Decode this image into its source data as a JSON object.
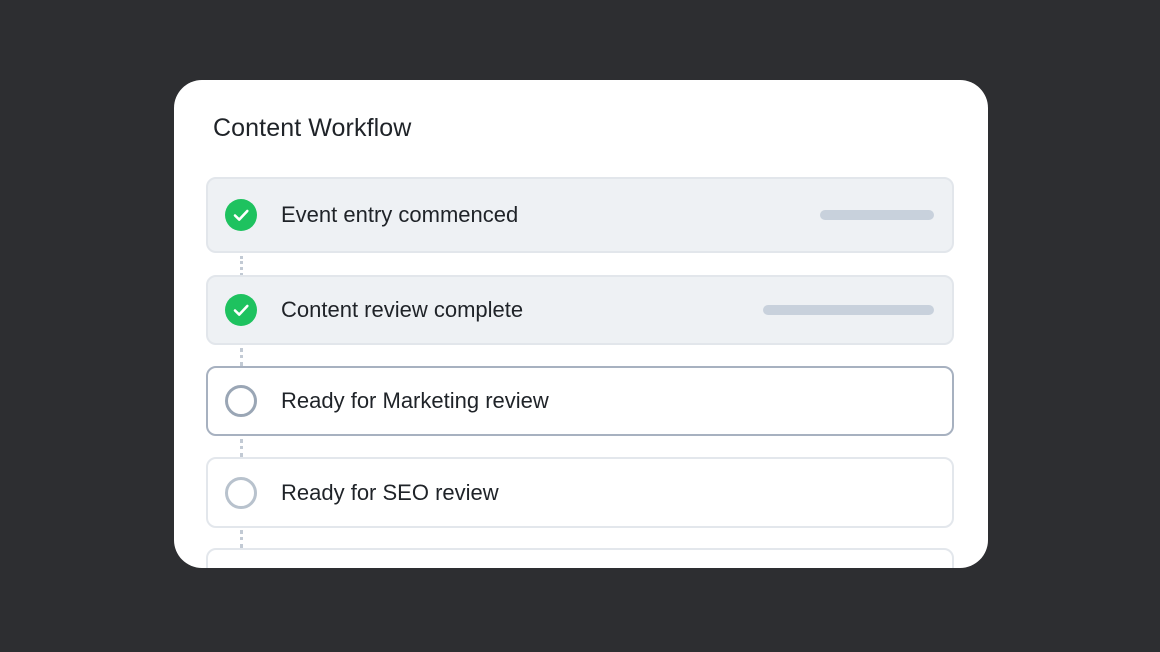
{
  "workflow": {
    "title": "Content Workflow",
    "steps": [
      {
        "label": "Event entry commenced",
        "status": "complete"
      },
      {
        "label": "Content review complete",
        "status": "complete"
      },
      {
        "label": "Ready for Marketing review",
        "status": "current"
      },
      {
        "label": "Ready for SEO review",
        "status": "pending"
      },
      {
        "label": "",
        "status": "pending"
      }
    ]
  },
  "icons": {
    "complete": "checkmark-circle-icon",
    "pending": "empty-circle-icon"
  },
  "colors": {
    "background": "#2d2e31",
    "card": "#ffffff",
    "complete_green": "#1ec25f",
    "done_row_bg": "#eef1f4",
    "active_border": "#a7b1c0"
  }
}
